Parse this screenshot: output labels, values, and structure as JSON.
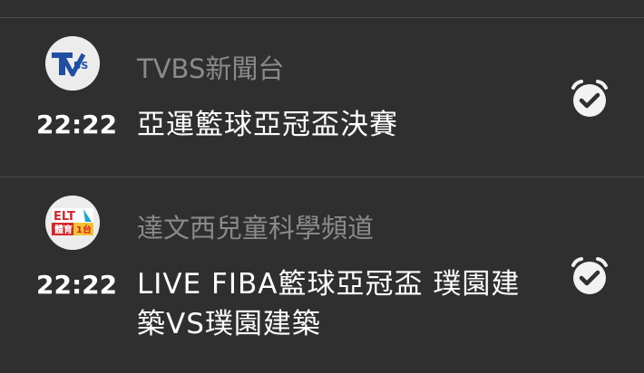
{
  "programs": [
    {
      "channel_logo_text": "TVBS",
      "channel": "TVBS新聞台",
      "time": "22:22",
      "title": "亞運籃球亞冠盃決賽",
      "alarm_icon": "alarm-check-icon"
    },
    {
      "channel_logo_text": "ELTA 體育1台",
      "channel": "達文西兒童科學頻道",
      "time": "22:22",
      "title": "LIVE FIBA籃球亞冠盃 璞園建築VS璞園建築",
      "alarm_icon": "alarm-check-icon"
    }
  ],
  "colors": {
    "background": "#2f2f2f",
    "divider": "#4a4a4a",
    "channel_text": "#8a8a8a",
    "primary_text": "#ffffff",
    "tvbs_blue": "#1f4ea3",
    "elta_red": "#d8232a",
    "elta_yellow": "#f2c230"
  }
}
